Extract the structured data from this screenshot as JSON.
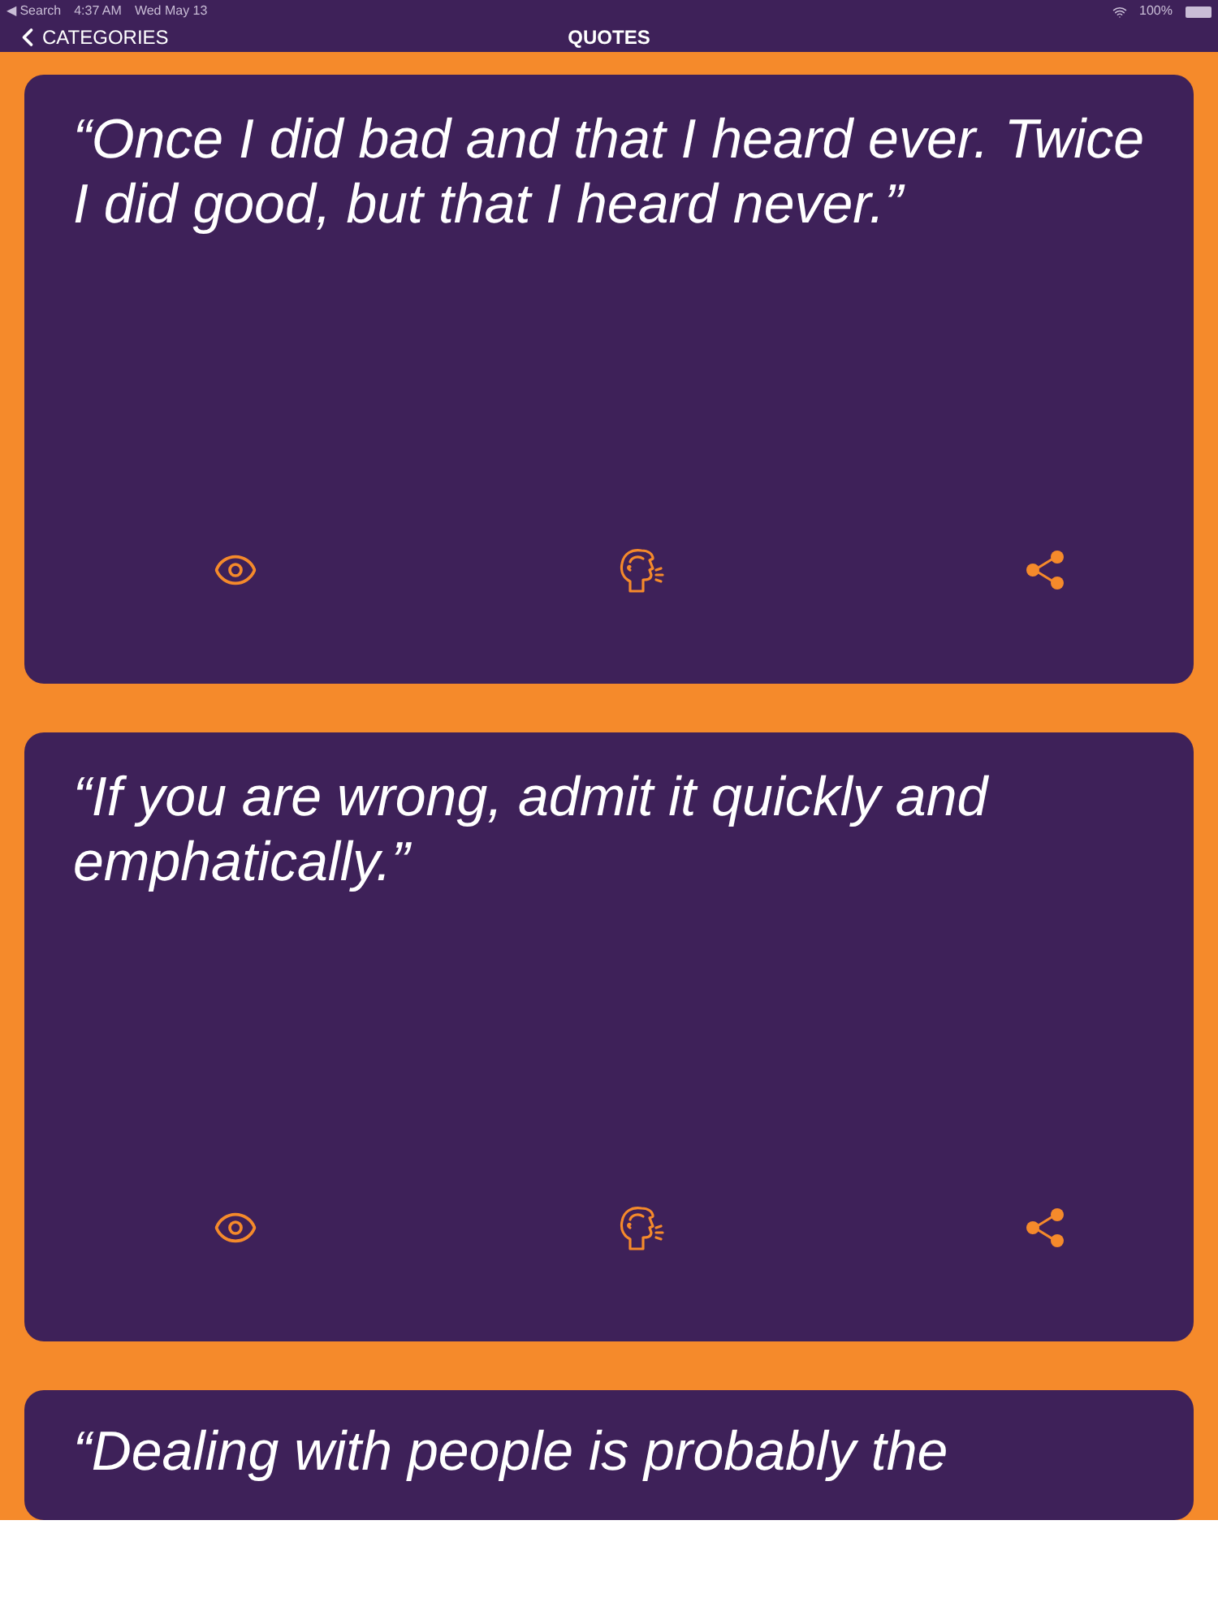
{
  "status_bar": {
    "back_app": "◀ Search",
    "time": "4:37 AM",
    "date": "Wed May 13",
    "battery": "100%"
  },
  "nav": {
    "back": "CATEGORIES",
    "title": "QUOTES"
  },
  "quotes": [
    {
      "text": "“Once I did bad and that I heard ever. Twice I did good, but that I heard never.”"
    },
    {
      "text": "“If you are wrong, admit it quickly and emphatically.”"
    },
    {
      "text": "“Dealing with people is probably the"
    }
  ]
}
